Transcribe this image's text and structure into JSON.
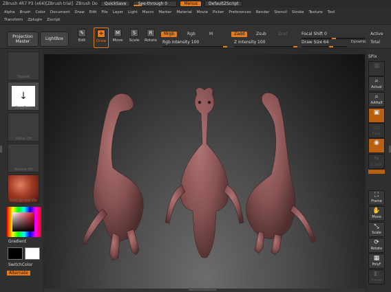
{
  "titlebar": {
    "app_title": "ZBrush 4R7 P3 (x64)[ZBrush trial]",
    "doc_label": "ZBrush Do",
    "quicksave": "QuickSave",
    "seethrough": "See-through   0",
    "menus": "Menus",
    "script": "DefaultZScript"
  },
  "menu_rows": [
    [
      "Alpha",
      "Brush",
      "Color",
      "Document",
      "Draw",
      "Edit",
      "File",
      "Layer",
      "Light",
      "Macro",
      "Marker",
      "Material",
      "Movie",
      "Picker",
      "Preferences",
      "Render",
      "Stencil",
      "Stroke",
      "Texture",
      "Tool"
    ],
    [
      "Transform",
      "Zplugin",
      "Zscript"
    ]
  ],
  "toolbar": {
    "projection_master_1": "Projection",
    "projection_master_2": "Master",
    "lightbox": "LightBox",
    "edit": "Edit",
    "draw": "Draw",
    "move": "Move",
    "scale": "Scale",
    "rotate": "Rotate",
    "mrgb": "Mrgb",
    "rgb": "Rgb",
    "m": "M",
    "rgb_intensity": "Rgb Intensity 100",
    "zadd": "Zadd",
    "zsub": "Zsub",
    "zcut": "Zcut",
    "z_intensity": "Z Intensity 100",
    "focal_shift": "Focal Shift 0",
    "draw_size": "Draw Size 64",
    "dynamic": "Dynamic",
    "active": "Active",
    "total": "Total"
  },
  "left_panel": {
    "tile1_caption": "Square",
    "dragrect_caption": "DragRect",
    "alpha_caption": "Alpha Off",
    "texture_caption": "Texture Off",
    "matcap_caption": "MatCap Red Wa",
    "gradient": "Gradient",
    "switchcolor": "SwitchColor",
    "alternate": "Alternate"
  },
  "right_panel": {
    "spix": "SPix",
    "actual": "Actual",
    "aahalf": "AAHalf",
    "floor": "Floor",
    "local": "Local",
    "lsym": "L.Sym",
    "frame": "Frame",
    "move": "Move",
    "scale": "Scale",
    "rotate": "Rotate",
    "polyf": "PolyF",
    "transp": "Transp",
    "ghost": "Ghost"
  },
  "colors": {
    "accent": "#e37a1d",
    "model": "#8a5a5a",
    "model_shadow": "#5a3a3a"
  }
}
